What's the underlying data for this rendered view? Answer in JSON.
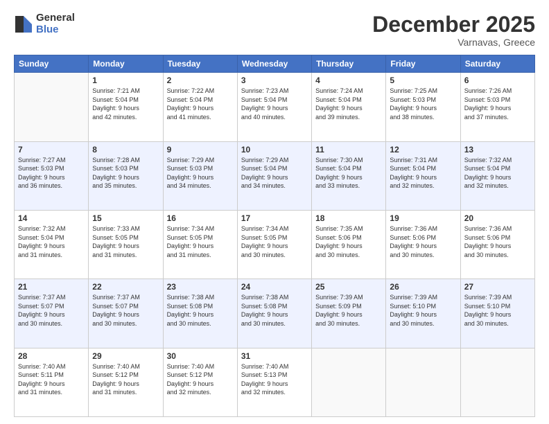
{
  "header": {
    "logo_general": "General",
    "logo_blue": "Blue",
    "month_title": "December 2025",
    "location": "Varnavas, Greece"
  },
  "weekdays": [
    "Sunday",
    "Monday",
    "Tuesday",
    "Wednesday",
    "Thursday",
    "Friday",
    "Saturday"
  ],
  "weeks": [
    [
      {
        "day": "",
        "info": ""
      },
      {
        "day": "1",
        "info": "Sunrise: 7:21 AM\nSunset: 5:04 PM\nDaylight: 9 hours\nand 42 minutes."
      },
      {
        "day": "2",
        "info": "Sunrise: 7:22 AM\nSunset: 5:04 PM\nDaylight: 9 hours\nand 41 minutes."
      },
      {
        "day": "3",
        "info": "Sunrise: 7:23 AM\nSunset: 5:04 PM\nDaylight: 9 hours\nand 40 minutes."
      },
      {
        "day": "4",
        "info": "Sunrise: 7:24 AM\nSunset: 5:04 PM\nDaylight: 9 hours\nand 39 minutes."
      },
      {
        "day": "5",
        "info": "Sunrise: 7:25 AM\nSunset: 5:03 PM\nDaylight: 9 hours\nand 38 minutes."
      },
      {
        "day": "6",
        "info": "Sunrise: 7:26 AM\nSunset: 5:03 PM\nDaylight: 9 hours\nand 37 minutes."
      }
    ],
    [
      {
        "day": "7",
        "info": "Sunrise: 7:27 AM\nSunset: 5:03 PM\nDaylight: 9 hours\nand 36 minutes."
      },
      {
        "day": "8",
        "info": "Sunrise: 7:28 AM\nSunset: 5:03 PM\nDaylight: 9 hours\nand 35 minutes."
      },
      {
        "day": "9",
        "info": "Sunrise: 7:29 AM\nSunset: 5:03 PM\nDaylight: 9 hours\nand 34 minutes."
      },
      {
        "day": "10",
        "info": "Sunrise: 7:29 AM\nSunset: 5:04 PM\nDaylight: 9 hours\nand 34 minutes."
      },
      {
        "day": "11",
        "info": "Sunrise: 7:30 AM\nSunset: 5:04 PM\nDaylight: 9 hours\nand 33 minutes."
      },
      {
        "day": "12",
        "info": "Sunrise: 7:31 AM\nSunset: 5:04 PM\nDaylight: 9 hours\nand 32 minutes."
      },
      {
        "day": "13",
        "info": "Sunrise: 7:32 AM\nSunset: 5:04 PM\nDaylight: 9 hours\nand 32 minutes."
      }
    ],
    [
      {
        "day": "14",
        "info": "Sunrise: 7:32 AM\nSunset: 5:04 PM\nDaylight: 9 hours\nand 31 minutes."
      },
      {
        "day": "15",
        "info": "Sunrise: 7:33 AM\nSunset: 5:05 PM\nDaylight: 9 hours\nand 31 minutes."
      },
      {
        "day": "16",
        "info": "Sunrise: 7:34 AM\nSunset: 5:05 PM\nDaylight: 9 hours\nand 31 minutes."
      },
      {
        "day": "17",
        "info": "Sunrise: 7:34 AM\nSunset: 5:05 PM\nDaylight: 9 hours\nand 30 minutes."
      },
      {
        "day": "18",
        "info": "Sunrise: 7:35 AM\nSunset: 5:06 PM\nDaylight: 9 hours\nand 30 minutes."
      },
      {
        "day": "19",
        "info": "Sunrise: 7:36 AM\nSunset: 5:06 PM\nDaylight: 9 hours\nand 30 minutes."
      },
      {
        "day": "20",
        "info": "Sunrise: 7:36 AM\nSunset: 5:06 PM\nDaylight: 9 hours\nand 30 minutes."
      }
    ],
    [
      {
        "day": "21",
        "info": "Sunrise: 7:37 AM\nSunset: 5:07 PM\nDaylight: 9 hours\nand 30 minutes."
      },
      {
        "day": "22",
        "info": "Sunrise: 7:37 AM\nSunset: 5:07 PM\nDaylight: 9 hours\nand 30 minutes."
      },
      {
        "day": "23",
        "info": "Sunrise: 7:38 AM\nSunset: 5:08 PM\nDaylight: 9 hours\nand 30 minutes."
      },
      {
        "day": "24",
        "info": "Sunrise: 7:38 AM\nSunset: 5:08 PM\nDaylight: 9 hours\nand 30 minutes."
      },
      {
        "day": "25",
        "info": "Sunrise: 7:39 AM\nSunset: 5:09 PM\nDaylight: 9 hours\nand 30 minutes."
      },
      {
        "day": "26",
        "info": "Sunrise: 7:39 AM\nSunset: 5:10 PM\nDaylight: 9 hours\nand 30 minutes."
      },
      {
        "day": "27",
        "info": "Sunrise: 7:39 AM\nSunset: 5:10 PM\nDaylight: 9 hours\nand 30 minutes."
      }
    ],
    [
      {
        "day": "28",
        "info": "Sunrise: 7:40 AM\nSunset: 5:11 PM\nDaylight: 9 hours\nand 31 minutes."
      },
      {
        "day": "29",
        "info": "Sunrise: 7:40 AM\nSunset: 5:12 PM\nDaylight: 9 hours\nand 31 minutes."
      },
      {
        "day": "30",
        "info": "Sunrise: 7:40 AM\nSunset: 5:12 PM\nDaylight: 9 hours\nand 32 minutes."
      },
      {
        "day": "31",
        "info": "Sunrise: 7:40 AM\nSunset: 5:13 PM\nDaylight: 9 hours\nand 32 minutes."
      },
      {
        "day": "",
        "info": ""
      },
      {
        "day": "",
        "info": ""
      },
      {
        "day": "",
        "info": ""
      }
    ]
  ]
}
